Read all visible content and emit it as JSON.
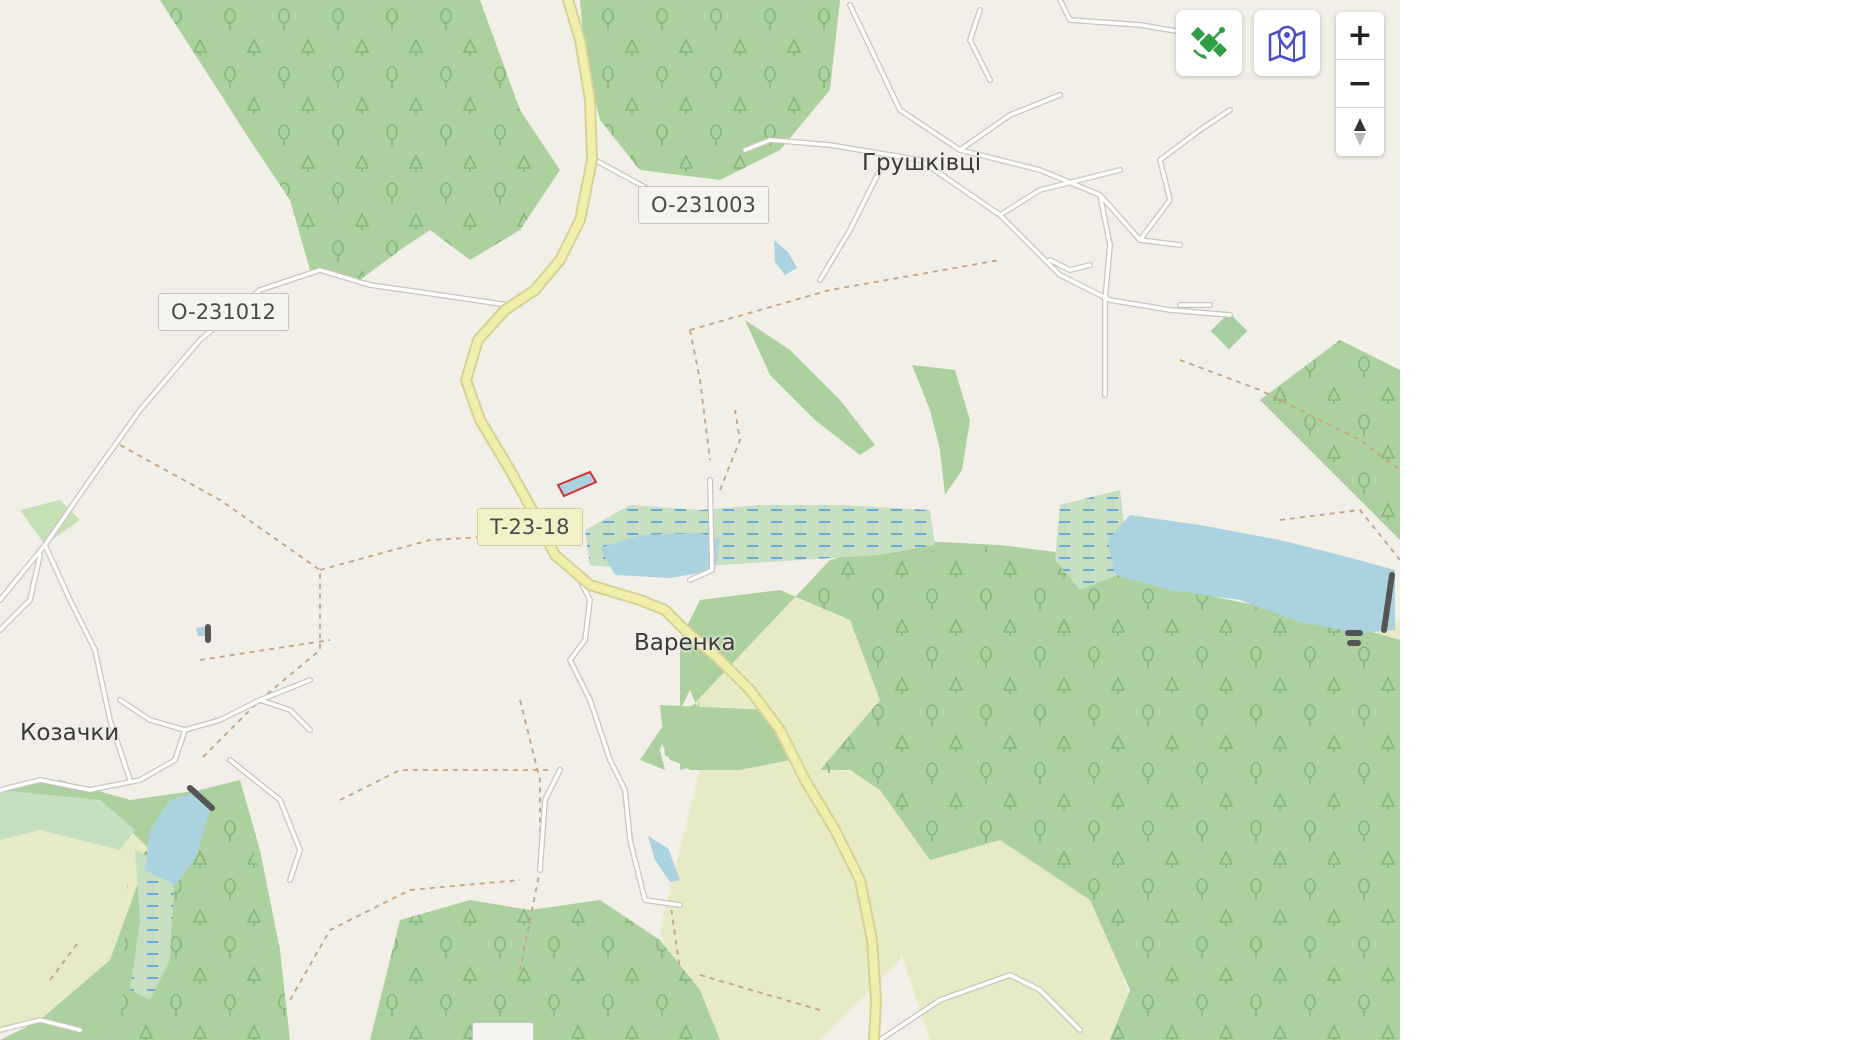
{
  "map": {
    "places": [
      {
        "name": "Грушківці"
      },
      {
        "name": "Варенка"
      },
      {
        "name": "Козачки"
      }
    ],
    "road_refs": [
      {
        "ref": "O-231003"
      },
      {
        "ref": "O-231012"
      },
      {
        "ref": "T-23-18"
      }
    ]
  },
  "controls": {
    "satellite_icon": "satellite-icon",
    "map_pin_icon": "map-pin-icon",
    "zoom_in": "+",
    "zoom_out": "−",
    "compass": "compass-icon"
  },
  "colors": {
    "land": "#f2efe9",
    "forest": "#add19e",
    "meadow": "#e8ecca",
    "water": "#aad3df",
    "primary_road": "#f1eeab",
    "satellite_icon": "#2f9e44",
    "map_pin_icon": "#4c4fc4"
  }
}
